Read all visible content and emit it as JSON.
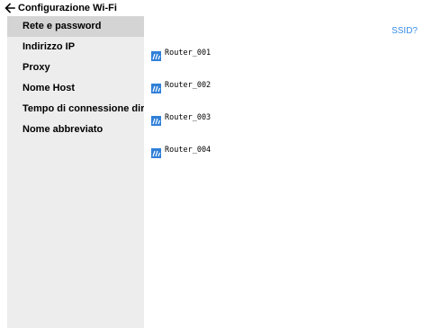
{
  "header": {
    "title": "Configurazione Wi-Fi",
    "back_icon": "arrow-left-icon"
  },
  "sidebar": {
    "items": [
      {
        "label": "Rete e password",
        "active": true
      },
      {
        "label": "Indirizzo IP",
        "active": false
      },
      {
        "label": "Proxy",
        "active": false
      },
      {
        "label": "Nome Host",
        "active": false
      },
      {
        "label": "Tempo di connessione dir",
        "active": false
      },
      {
        "label": "Nome abbreviato",
        "active": false
      }
    ]
  },
  "main": {
    "ssid_link": "SSID?",
    "networks": [
      {
        "name": "Router_001",
        "icon": "wifi-icon"
      },
      {
        "name": "Router_002",
        "icon": "wifi-icon"
      },
      {
        "name": "Router_003",
        "icon": "wifi-icon"
      },
      {
        "name": "Router_004",
        "icon": "wifi-icon"
      }
    ]
  },
  "colors": {
    "accent": "#3a8ee6",
    "sidebar_bg": "#ededed",
    "sidebar_active": "#d4d4d4"
  }
}
